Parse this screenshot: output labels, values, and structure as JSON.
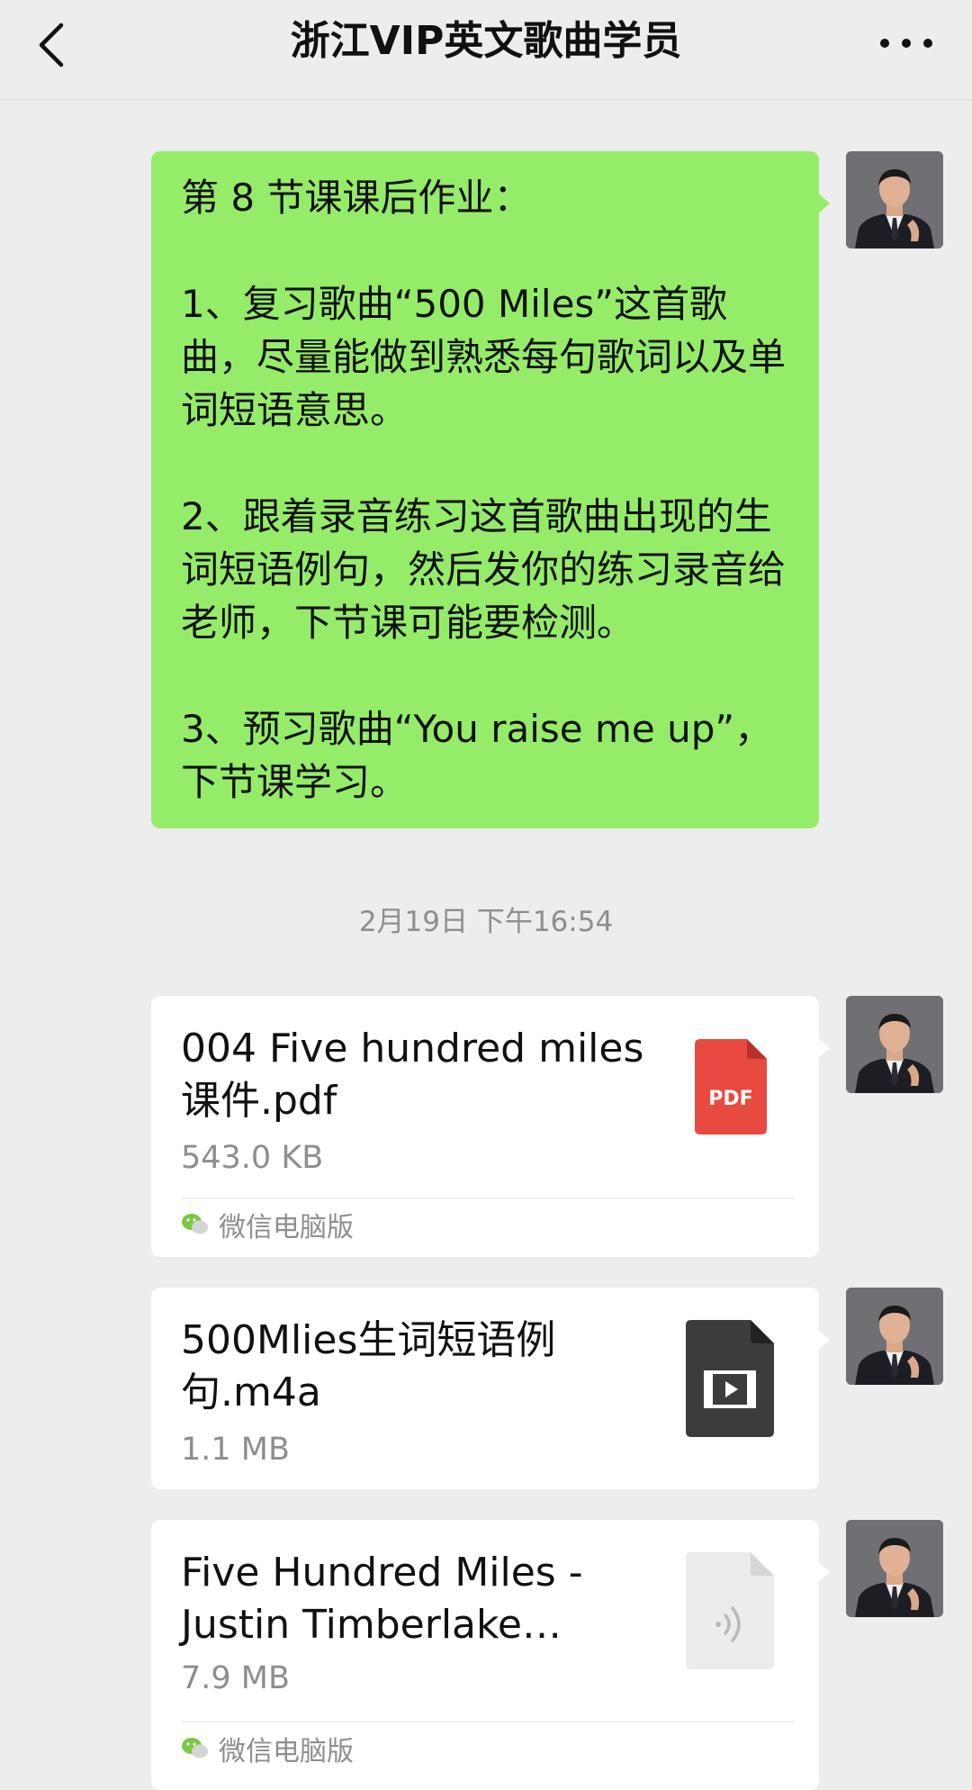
{
  "header": {
    "title": "浙江VIP英文歌曲学员"
  },
  "icons": {
    "back": "chevron-left-icon",
    "more": "more-horizontal-icon",
    "pdf": "pdf-file-icon",
    "video": "video-file-icon",
    "audio": "audio-file-icon",
    "wechat": "wechat-logo-icon"
  },
  "colors": {
    "background": "#ededed",
    "self_bubble": "#95ec69",
    "file_bubble": "#ffffff",
    "pdf_red": "#e94a3f",
    "video_dark": "#3c3c3c",
    "audio_light": "#ececec"
  },
  "messages": {
    "homework": {
      "text": "第 8 节课课后作业：\n\n1、复习歌曲“500 Miles”这首歌曲，尽量能做到熟悉每句歌词以及单词短语意思。\n\n2、跟着录音练习这首歌曲出现的生词短语例句，然后发你的练习录音给老师，下节课可能要检测。\n\n3、预习歌曲“You raise me up”，下节课学习。"
    },
    "timestamp": "2月19日 下午16:54",
    "files": [
      {
        "name": "004 Five hundred miles 课件.pdf",
        "size": "543.0 KB",
        "icon_label": "PDF",
        "source": "微信电脑版"
      },
      {
        "name": "500Mlies生词短语例句.m4a",
        "size": "1.1 MB"
      },
      {
        "name": "Five Hundred Miles - Justin Timberlake…",
        "size": "7.9 MB",
        "source": "微信电脑版"
      }
    ]
  }
}
